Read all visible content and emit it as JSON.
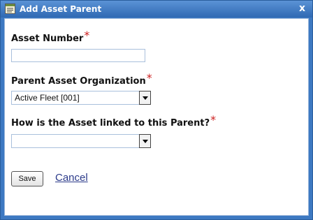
{
  "window": {
    "title": "Add Asset Parent",
    "close_label": "x"
  },
  "form": {
    "asset_number": {
      "label": "Asset Number",
      "required_mark": "*",
      "value": ""
    },
    "parent_org": {
      "label": "Parent Asset Organization",
      "required_mark": "*",
      "selected": "Active Fleet [001]"
    },
    "link_type": {
      "label": "How is the Asset linked to this Parent?",
      "required_mark": "*",
      "selected": ""
    }
  },
  "actions": {
    "save_label": "Save",
    "cancel_label": "Cancel"
  },
  "colors": {
    "accent": "#3d79c2",
    "required": "#cc1f1f",
    "link": "#2b3a8a"
  },
  "icons": {
    "title": "form-window-icon",
    "dropdown": "chevron-down-icon"
  }
}
